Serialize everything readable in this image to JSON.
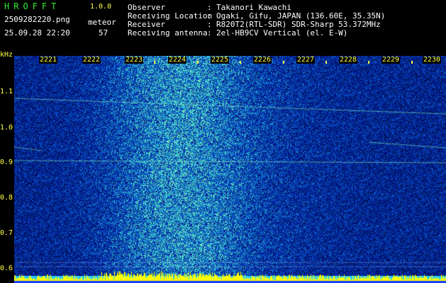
{
  "header": {
    "app_name": "HROFFT",
    "app_version": "1.0.0",
    "file_name": "2509282220.png",
    "datetime": "25.09.28 22:20",
    "event_label": "meteor",
    "event_count": "57",
    "info": [
      {
        "label": "Observer",
        "value": "Takanori Kawachi"
      },
      {
        "label": "Receiving Location",
        "value": "Ogaki, Gifu, JAPAN (136.60E, 35.35N)"
      },
      {
        "label": "Receiver",
        "value": "R820T2(RTL-SDR) SDR-Sharp 53.372MHz"
      },
      {
        "label": "Receiving antenna",
        "value": "2el-HB9CV Vertical (el. E-W)"
      }
    ]
  },
  "axes": {
    "y_unit": "kHz",
    "y_ticks": [
      "1.1",
      "1.0",
      "0.9",
      "0.8",
      "0.7",
      "0.6"
    ],
    "x_ticks": [
      "2221",
      "2222",
      "2223",
      "2224",
      "2225",
      "2226",
      "2227",
      "2228",
      "2229",
      "2230"
    ]
  },
  "colors": {
    "background": "#000000",
    "header_text": "#ffffff",
    "title_green": "#33ee33",
    "axis_yellow": "#ffff44",
    "spectrogram_noise": "#1a2aa8",
    "spectrogram_hot": "#88ffcc",
    "baseline_yellow": "#ffff00",
    "baseline_cyan": "#22ccff"
  }
}
